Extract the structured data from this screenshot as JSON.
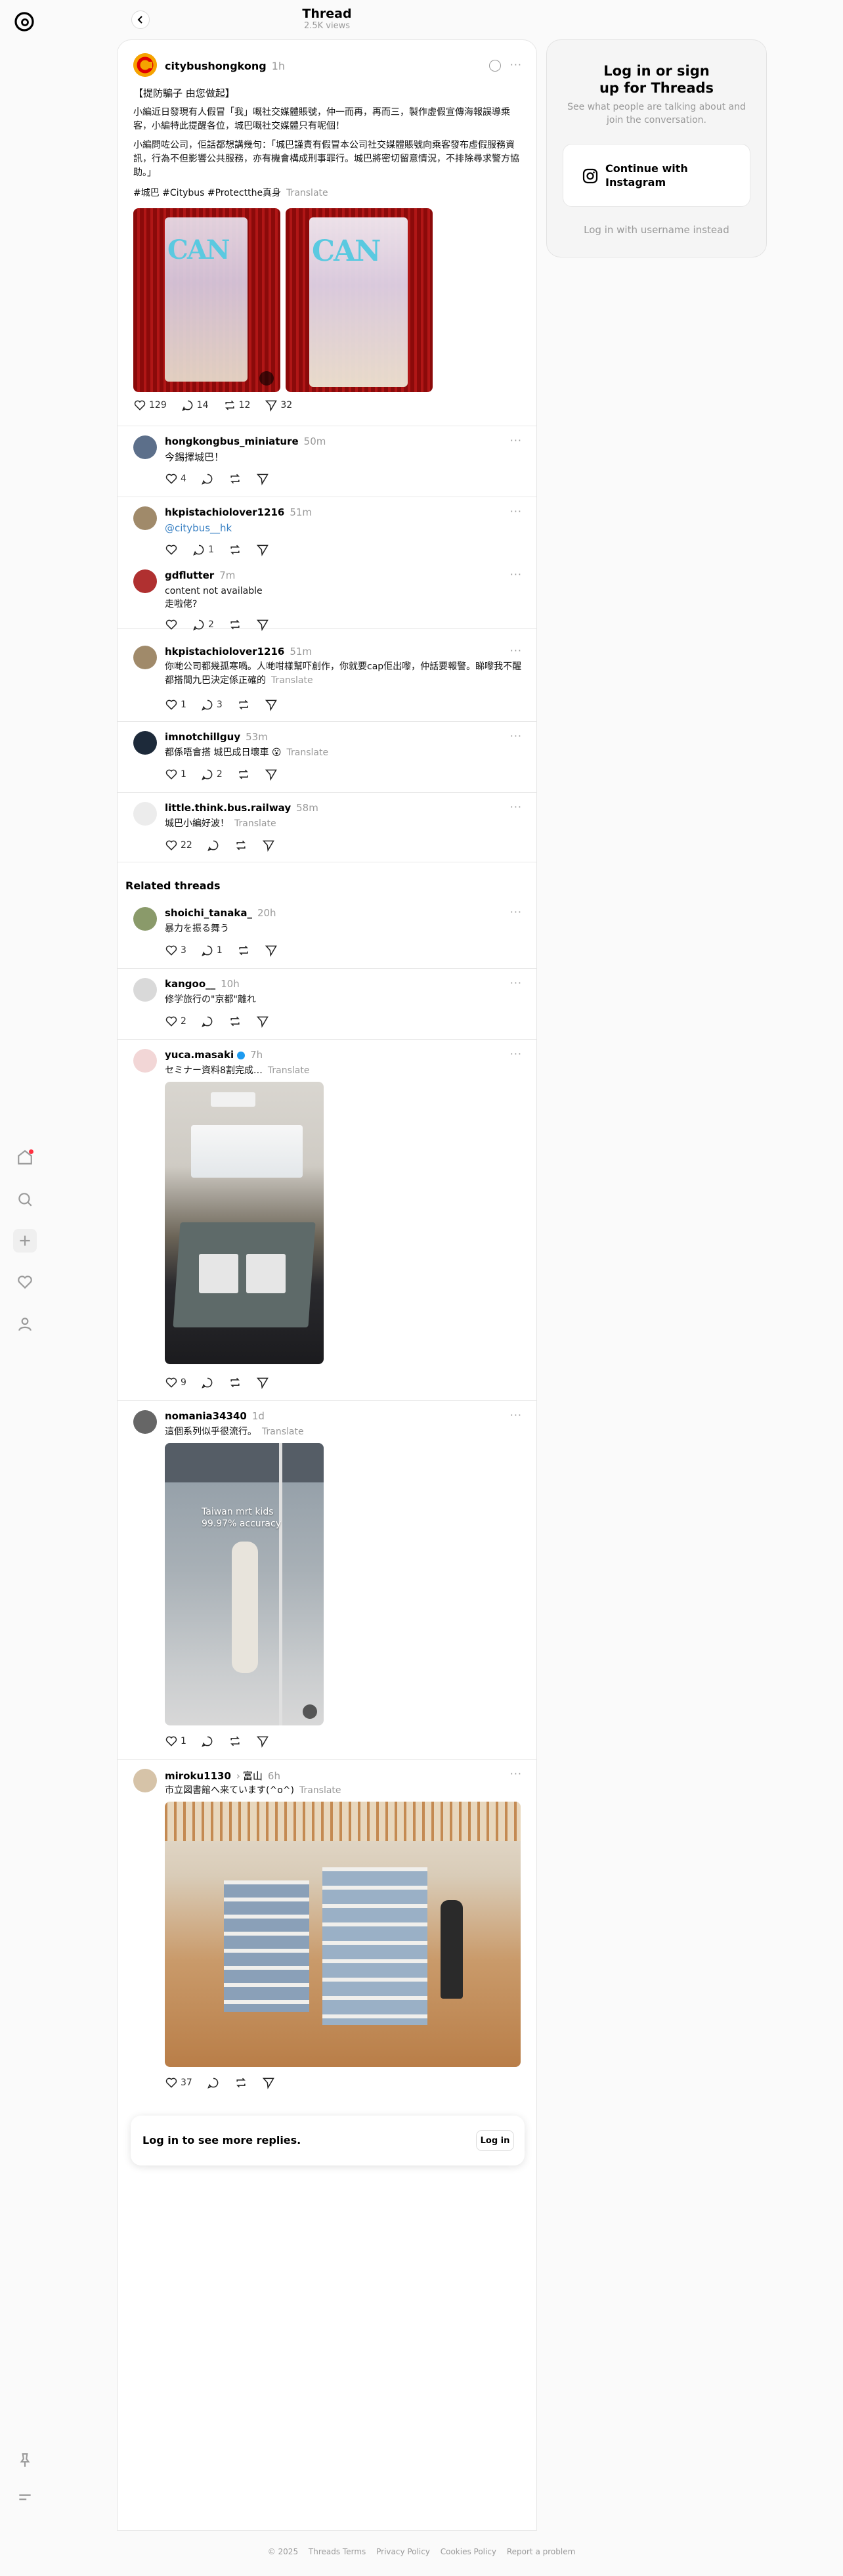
{
  "header": {
    "title": "Thread",
    "views": "2.5K views"
  },
  "main_post": {
    "username": "citybushongkong",
    "time": "1h",
    "line1": "【提防騙子 由您做起】",
    "para1": "小編近日發現有人假冒「我」嘅社交媒體賬號，仲一而再，再而三，製作虛假宣傳海報誤導乘客，小編特此提醒各位，城巴嘅社交媒體只有呢個！",
    "para2": "小編問咗公司，佢話都想講幾句：「城巴謹責有假冒本公司社交媒體賬號向乘客發布虛假服務資訊，行為不但影響公共服務，亦有機會構成刑事罪行。城巴將密切留意情況，不排除尋求警方協助。」",
    "tags": "#城巴 #Citybus #Protectthe真身",
    "translate": "Translate",
    "likes": "129",
    "replies": "14",
    "reposts": "12",
    "shares": "32"
  },
  "replies": [
    {
      "username": "hongkongbus_miniature",
      "time": "50m",
      "text": "今錫擇城巴！",
      "likes": "4"
    },
    {
      "username": "hkpistachiolover1216",
      "time": "51m",
      "text": "@citybus__hk",
      "replies": "1"
    },
    {
      "username": "gdflutter",
      "time": "7m",
      "text": "content not available",
      "text2": "走啦佬?",
      "replies": "2"
    },
    {
      "username": "hkpistachiolover1216",
      "time": "51m",
      "text": "你哋公司都幾孤寒喎。人哋咁樣幫吓創作，你就要cap佢出嚟，仲話要報警。睇嚟我不醒都搭間九巴決定係正確的",
      "likes": "1",
      "replies": "3"
    },
    {
      "username": "imnotchillguy",
      "time": "53m",
      "text": "都係唔會搭 城巴成日壞車 😮",
      "likes": "1",
      "replies": "2"
    },
    {
      "username": "little.think.bus.railway",
      "time": "58m",
      "text": "城巴小編好波！",
      "likes": "22"
    }
  ],
  "related": {
    "heading": "Related threads",
    "items": [
      {
        "username": "shoichi_tanaka_",
        "time": "20h",
        "text": "暴力を振る舞う",
        "likes": "3",
        "replies": "1"
      },
      {
        "username": "kangoo__",
        "time": "10h",
        "text": "修学旅行の\"京都\"離れ",
        "likes": "2"
      },
      {
        "username": "yuca.masaki",
        "time": "7h",
        "text": "セミナー資料8割完成…",
        "likes": "9"
      },
      {
        "username": "nomania34340",
        "time": "1d",
        "text": "這個系列似乎很流行。",
        "video_caption1": "Taiwan mrt kids",
        "video_caption2": "99.97% accuracy",
        "likes": "1"
      },
      {
        "username": "miroku1130",
        "place": "富山",
        "time": "6h",
        "text": "市立図書館へ来ています(^o^)",
        "likes": "37"
      }
    ]
  },
  "login_prompt": {
    "text": "Log in to see more replies.",
    "button": "Log in"
  },
  "right_panel": {
    "title": "Log in or sign up for Threads",
    "subtitle": "See what people are talking about and join the conversation.",
    "button": "Continue with Instagram",
    "alt_link": "Log in with username instead"
  },
  "footer": {
    "copyright": "© 2025",
    "terms": "Threads Terms",
    "privacy": "Privacy Policy",
    "cookies": "Cookies Policy",
    "report": "Report a problem"
  },
  "icons": [
    "threads-logo-icon",
    "home-icon",
    "search-icon",
    "create-icon",
    "heart-icon",
    "profile-icon",
    "pin-icon",
    "menu-icon"
  ],
  "colors": {
    "accent_red": "#ff3040",
    "link": "#3b82c4",
    "citybus_orange": "#f39800"
  }
}
